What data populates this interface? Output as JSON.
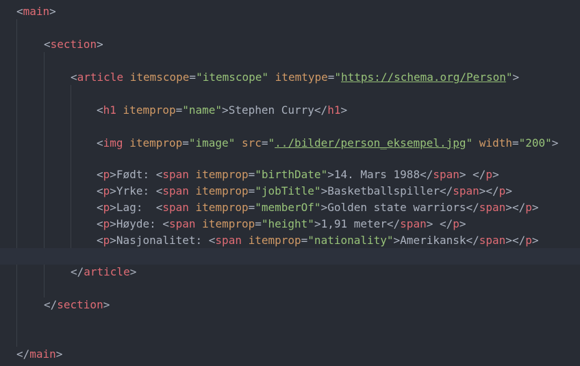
{
  "code": {
    "l1": {
      "open": "<",
      "tag": "main",
      "close": ">"
    },
    "l2": {
      "open": "<",
      "tag": "section",
      "close": ">"
    },
    "l3": {
      "open": "<",
      "tag": "article",
      "sp1": " ",
      "attr1": "itemscope",
      "eq1": "=",
      "val1": "\"itemscope\"",
      "sp2": " ",
      "attr2": "itemtype",
      "eq2": "=",
      "q1": "\"",
      "url": "https://schema.org/Person",
      "q2": "\"",
      "close": ">"
    },
    "l4": {
      "open": "<",
      "tag": "h1",
      "sp": " ",
      "attr": "itemprop",
      "eq": "=",
      "val": "\"name\"",
      "close": ">",
      "text": "Stephen Curry",
      "endopen": "</",
      "endtag": "h1",
      "endclose": ">"
    },
    "l5": {
      "open": "<",
      "tag": "img",
      "sp1": " ",
      "attr1": "itemprop",
      "eq1": "=",
      "val1": "\"image\"",
      "sp2": " ",
      "attr2": "src",
      "eq2": "=",
      "q1": "\"",
      "src": "../bilder/person_eksempel.jpg",
      "q2": "\"",
      "sp3": " ",
      "attr3": "width",
      "eq3": "=",
      "val3": "\"200\"",
      "close": ">"
    },
    "l6": {
      "pOpen": "<",
      "pTag": "p",
      "pClose": ">",
      "label": "Født: ",
      "sOpen": "<",
      "sTag": "span",
      "sp": " ",
      "attr": "itemprop",
      "eq": "=",
      "val": "\"birthDate\"",
      "sClose": ">",
      "text": "14. Mars 1988",
      "seOpen": "</",
      "seTag": "span",
      "seClose": ">",
      "gap": " ",
      "peOpen": "</",
      "peTag": "p",
      "peClose": ">"
    },
    "l7": {
      "pOpen": "<",
      "pTag": "p",
      "pClose": ">",
      "label": "Yrke: ",
      "sOpen": "<",
      "sTag": "span",
      "sp": " ",
      "attr": "itemprop",
      "eq": "=",
      "val": "\"jobTitle\"",
      "sClose": ">",
      "text": "Basketballspiller",
      "seOpen": "</",
      "seTag": "span",
      "seClose": ">",
      "peOpen": "</",
      "peTag": "p",
      "peClose": ">"
    },
    "l8": {
      "pOpen": "<",
      "pTag": "p",
      "pClose": ">",
      "label": "Lag:  ",
      "sOpen": "<",
      "sTag": "span",
      "sp": " ",
      "attr": "itemprop",
      "eq": "=",
      "val": "\"memberOf\"",
      "sClose": ">",
      "text": "Golden state warriors",
      "seOpen": "</",
      "seTag": "span",
      "seClose": ">",
      "peOpen": "</",
      "peTag": "p",
      "peClose": ">"
    },
    "l9": {
      "pOpen": "<",
      "pTag": "p",
      "pClose": ">",
      "label": "Høyde: ",
      "sOpen": "<",
      "sTag": "span",
      "sp": " ",
      "attr": "itemprop",
      "eq": "=",
      "val": "\"height\"",
      "sClose": ">",
      "text": "1,91 meter",
      "seOpen": "</",
      "seTag": "span",
      "seClose": ">",
      "gap": " ",
      "peOpen": "</",
      "peTag": "p",
      "peClose": ">"
    },
    "l10": {
      "pOpen": "<",
      "pTag": "p",
      "pClose": ">",
      "label": "Nasjonalitet: ",
      "sOpen": "<",
      "sTag": "span",
      "sp": " ",
      "attr": "itemprop",
      "eq": "=",
      "val": "\"nationality\"",
      "sClose": ">",
      "text": "Amerikansk",
      "seOpen": "</",
      "seTag": "span",
      "seClose": ">",
      "peOpen": "</",
      "peTag": "p",
      "peClose": ">"
    },
    "l11": {
      "open": "</",
      "tag": "article",
      "close": ">"
    },
    "l12": {
      "open": "</",
      "tag": "section",
      "close": ">"
    },
    "l13": {
      "open": "</",
      "tag": "main",
      "close": ">"
    }
  },
  "colors": {
    "background": "#282c34",
    "tag": "#e06c75",
    "attribute": "#d19a66",
    "string": "#98c379",
    "punctuation": "#abb2bf"
  }
}
